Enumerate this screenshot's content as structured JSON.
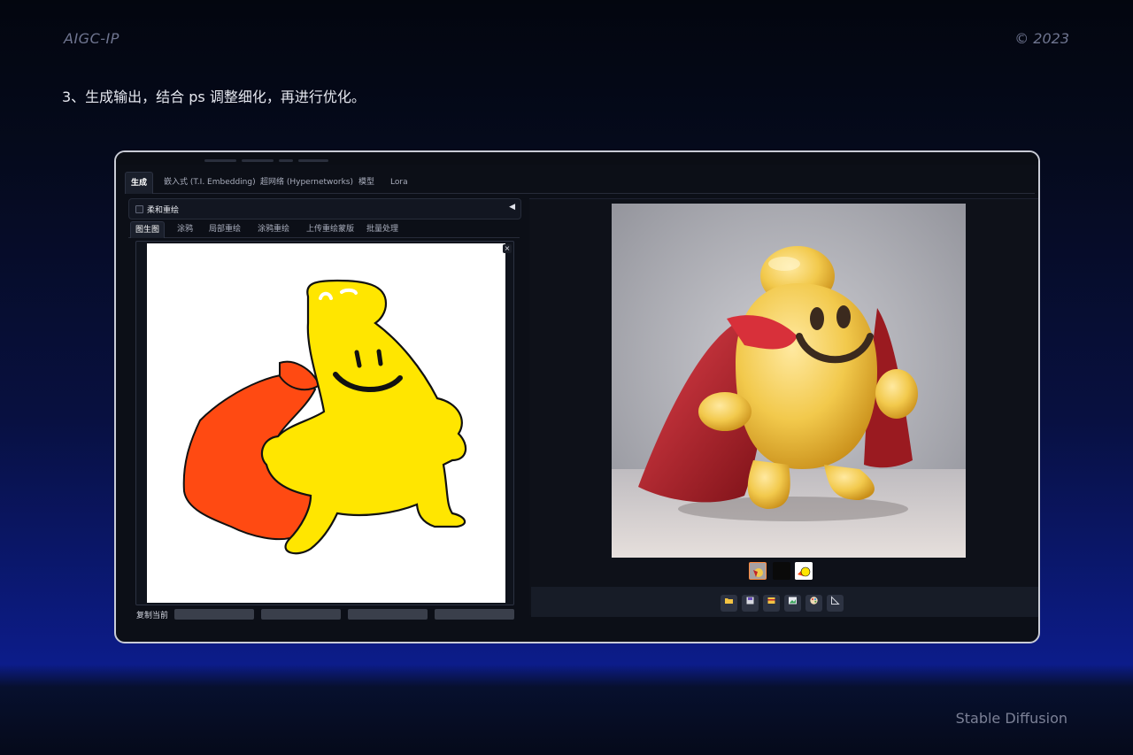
{
  "slide": {
    "header_left": "AIGC-IP",
    "header_right": "© 2023",
    "step_text": "3、生成输出，结合 ps 调整细化，再进行优化。",
    "footer": "Stable Diffusion"
  },
  "app": {
    "main_tabs": [
      {
        "label": "生成",
        "active": true
      },
      {
        "label": "嵌入式 (T.I. Embedding)",
        "active": false
      },
      {
        "label": "超网络 (Hypernetworks)",
        "active": false
      },
      {
        "label": "模型",
        "active": false
      },
      {
        "label": "Lora",
        "active": false
      }
    ],
    "accordion": {
      "label": "柔和重绘",
      "checked": false,
      "arrow": "◀"
    },
    "sub_tabs": [
      {
        "label": "图生图",
        "active": true
      },
      {
        "label": "涂鸦",
        "active": false
      },
      {
        "label": "局部重绘",
        "active": false
      },
      {
        "label": "涂鸦重绘",
        "active": false
      },
      {
        "label": "上传重绘蒙版",
        "active": false
      },
      {
        "label": "批量处理",
        "active": false
      }
    ],
    "canvas_close": "×",
    "copy_label": "复制当前",
    "toolbar_icons": [
      "folder-icon",
      "save-icon",
      "zip-icon",
      "send-to-img2img-icon",
      "palette-icon",
      "ruler-icon"
    ],
    "colors": {
      "accent_orange": "#ff8a3c",
      "sketch_yellow": "#ffe600",
      "sketch_cape": "#ff4a12",
      "render_yellow": "#f2c94c",
      "render_cape": "#c0242c"
    }
  }
}
